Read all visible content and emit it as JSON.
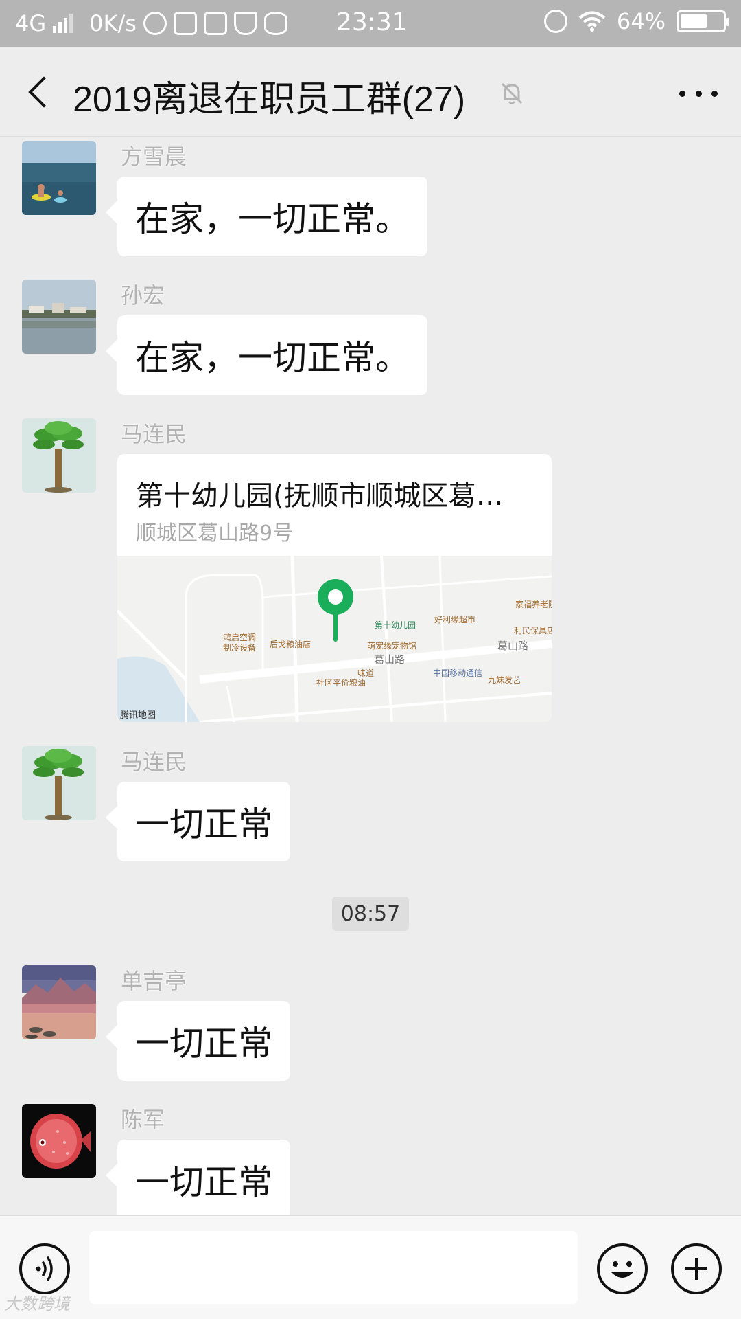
{
  "status_bar": {
    "network": "4G",
    "speed": "0K/s",
    "time": "23:31",
    "battery_percent": "64%",
    "battery_level": 0.64,
    "icons": [
      "signal-icon",
      "browser-icon",
      "notes-icon",
      "screenshot-icon",
      "shield-icon",
      "storage-icon",
      "alarm-icon",
      "wifi-icon",
      "battery-icon"
    ]
  },
  "header": {
    "title": "2019离退在职员工群(27)",
    "icons": [
      "back-icon",
      "mute-bell-icon",
      "more-icon"
    ]
  },
  "messages": [
    {
      "sender": "方雪晨",
      "text": "在家，一切正常。",
      "avatar": "sea-swimmers-photo"
    },
    {
      "sender": "孙宏",
      "text": "在家，一切正常。",
      "avatar": "lake-island-photo"
    },
    {
      "sender": "马连民",
      "type": "location",
      "avatar": "palm-tree-photo",
      "location": {
        "title": "第十幼儿园(抚顺市顺城区葛…",
        "address": "顺城区葛山路9号",
        "map_labels": [
          "家福养老院",
          "第十幼儿园",
          "好利缘超市",
          "利民保具店",
          "鸿启空调制冷设备",
          "后戈粮油店",
          "萌宠缘宠物馆",
          "葛山路",
          "葛山路",
          "味道",
          "中国移动通信",
          "九妹发艺",
          "社区平价粮油"
        ],
        "map_provider": "腾讯地图"
      }
    },
    {
      "sender": "马连民",
      "text": "一切正常",
      "avatar": "palm-tree-photo"
    },
    {
      "sender": "单吉亭",
      "text": "一切正常",
      "avatar": "mountain-lake-sunset-photo"
    },
    {
      "sender": "陈军",
      "text": "一切正常",
      "avatar": "red-discus-fish-photo"
    }
  ],
  "timestamp_divider": "08:57",
  "input_bar": {
    "value": "",
    "icons": [
      "voice-icon",
      "emoji-icon",
      "plus-icon"
    ]
  },
  "watermark": "大数跨境",
  "colors": {
    "status_bar_bg": "#b5b5b5",
    "chat_bg": "#ededed",
    "bubble_bg": "#ffffff",
    "map_pin": "#1aad5a",
    "sender_name": "#b3b3b3"
  }
}
